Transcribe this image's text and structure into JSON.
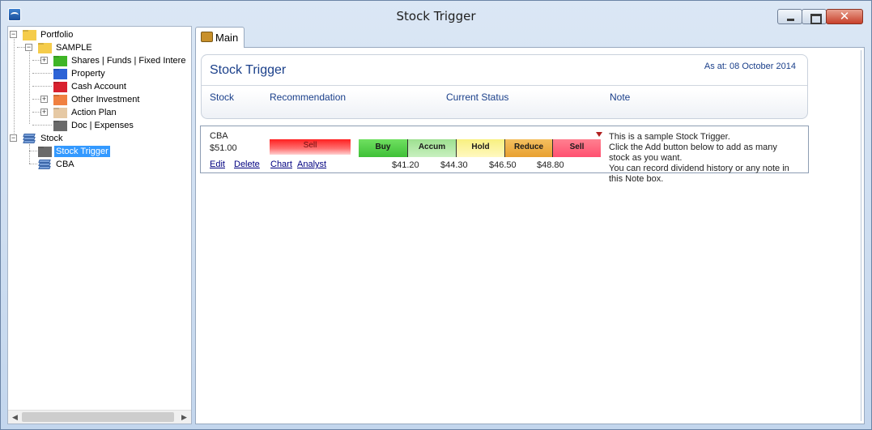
{
  "window": {
    "title": "Stock Trigger"
  },
  "tree": {
    "portfolio": "Portfolio",
    "sample": "SAMPLE",
    "shares": "Shares | Funds | Fixed Intere",
    "property": "Property",
    "cash": "Cash Account",
    "other": "Other Investment",
    "action": "Action Plan",
    "doc": "Doc | Expenses",
    "stock": "Stock",
    "stock_trigger": "Stock Trigger",
    "cba": "CBA"
  },
  "tab": {
    "label": "Main"
  },
  "header": {
    "title": "Stock Trigger",
    "as_at": "As at: 08 October 2014",
    "columns": [
      "Stock",
      "Recommendation",
      "Current Status",
      "Note"
    ]
  },
  "row": {
    "stock": "CBA",
    "price": "$51.00",
    "edit": "Edit",
    "delete": "Delete",
    "chart": "Chart",
    "analyst": "Analyst",
    "recommendation": "Sell",
    "segments": [
      "Buy",
      "Accum",
      "Hold",
      "Reduce",
      "Sell"
    ],
    "thresholds": [
      "$41.20",
      "$44.30",
      "$46.50",
      "$48.80"
    ],
    "note_lines": [
      "This is a sample Stock Trigger.",
      "Click the Add button below to add as many",
      "stock as you want.",
      "You can record dividend history or any note in",
      "this Note box."
    ]
  },
  "colors": {
    "accent_text": "#1a3f8a",
    "selection": "#3399ff"
  }
}
